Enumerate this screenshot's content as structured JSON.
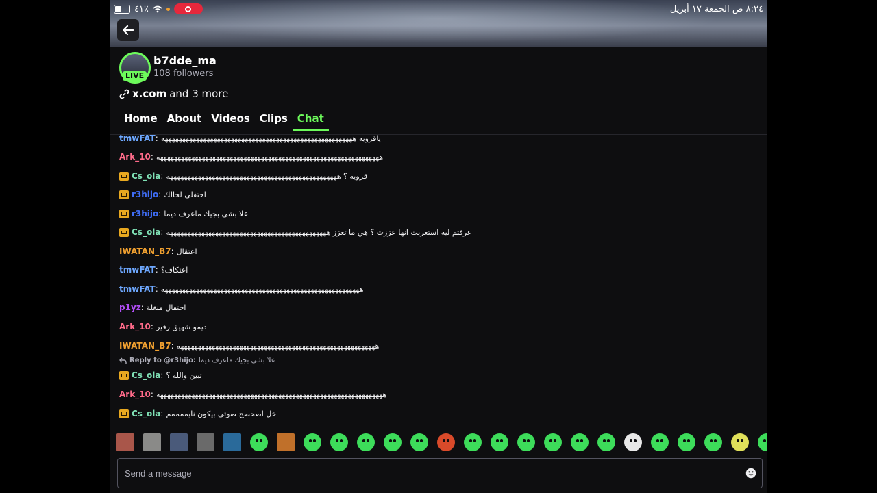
{
  "status_bar": {
    "time_date": "٨:٢٤ ص  الجمعة ١٧ أبريل",
    "battery_percent": "٤١٪"
  },
  "channel": {
    "username": "b7dde_ma",
    "followers": "108 followers",
    "live_badge": "LIVE",
    "link_main": "x.com",
    "link_more": "and 3 more"
  },
  "tabs": [
    {
      "label": "Home",
      "active": false
    },
    {
      "label": "About",
      "active": false
    },
    {
      "label": "Videos",
      "active": false
    },
    {
      "label": "Clips",
      "active": false
    },
    {
      "label": "Chat",
      "active": true
    }
  ],
  "messages": [
    {
      "user": "tmwFAT",
      "color": "#6ea8ff",
      "crown": false,
      "text": "ياقرويه هههههههههههههههههههههههههههههههههههههههههههههههههههههههه"
    },
    {
      "user": "Ark_10",
      "color": "#ff6b8a",
      "crown": false,
      "text": "ههههههههههههههههههههههههههههههههههههههههههههههههههههههههههههههههه"
    },
    {
      "user": "Cs_ola",
      "color": "#7fe0b5",
      "crown": true,
      "text": "قرويه ؟ هههههههههههههههههههههههههههههههههههههههههههههههههه"
    },
    {
      "user": "r3hijo",
      "color": "#3f6df6",
      "crown": true,
      "text": "احتفلي لحالك"
    },
    {
      "user": "r3hijo",
      "color": "#3f6df6",
      "crown": true,
      "text": "علا بشي بجيك ماعرف ديما"
    },
    {
      "user": "Cs_ola",
      "color": "#7fe0b5",
      "crown": true,
      "text": "عرفتم ليه استغربت انها عززت ؟ هي ما تعزز ههههههههههههههههههههههههههههههههههههههههههههههه"
    },
    {
      "user": "IWATAN_B7",
      "color": "#f0a030",
      "crown": false,
      "text": "اعتقال"
    },
    {
      "user": "tmwFAT",
      "color": "#6ea8ff",
      "crown": false,
      "text": "اعتكاف؟"
    },
    {
      "user": "tmwFAT",
      "color": "#6ea8ff",
      "crown": false,
      "text": "هههههههههههههههههههههههههههههههههههههههههههههههههههههههههه"
    },
    {
      "user": "p1yz",
      "color": "#b14ef7",
      "crown": false,
      "text": "احتفال منغلة"
    },
    {
      "user": "Ark_10",
      "color": "#ff6b8a",
      "crown": false,
      "text": "ديمو شهيق زفير"
    },
    {
      "user": "IWATAN_B7",
      "color": "#f0a030",
      "crown": false,
      "text": "هههههههههههههههههههههههههههههههههههههههههههههههههههههههههه"
    },
    {
      "user": "Cs_ola",
      "color": "#7fe0b5",
      "crown": true,
      "text": "تبين والله ؟"
    },
    {
      "user": "Ark_10",
      "color": "#ff6b8a",
      "crown": false,
      "text": "هههههههههههههههههههههههههههههههههههههههههههههههههههههههههههههههههه"
    },
    {
      "user": "Cs_ola",
      "color": "#7fe0b5",
      "crown": true,
      "text": "خل اصحصح صوتي بيكون نايممممم"
    }
  ],
  "reply": {
    "prefix": "Reply to @r3hijo:",
    "text": "علا بشي بجيك ماعرف ديما"
  },
  "emotes": [
    {
      "name": "avatar-emote-1",
      "color": "#a9564a",
      "photo": true
    },
    {
      "name": "avatar-emote-2",
      "color": "#8a8a88",
      "photo": true
    },
    {
      "name": "avatar-emote-3",
      "color": "#4a5a7a",
      "photo": true
    },
    {
      "name": "avatar-emote-4",
      "color": "#6a6a6a",
      "photo": true
    },
    {
      "name": "avatar-emote-5",
      "color": "#2a6a9a",
      "photo": true
    },
    {
      "name": "halo-emote",
      "color": "#3ddc5a",
      "photo": false
    },
    {
      "name": "box-emote",
      "color": "#c0702a",
      "photo": true
    },
    {
      "name": "dizzy-emote",
      "color": "#3ddc5a",
      "photo": false
    },
    {
      "name": "wink-emote",
      "color": "#3ddc5a",
      "photo": false
    },
    {
      "name": "headphones-emote",
      "color": "#3ddc5a",
      "photo": false
    },
    {
      "name": "smile-emote",
      "color": "#3ddc5a",
      "photo": false
    },
    {
      "name": "blob-emote",
      "color": "#3ddc5a",
      "photo": false
    },
    {
      "name": "mushroom-emote",
      "color": "#d94a2a",
      "photo": false
    },
    {
      "name": "grin-emote",
      "color": "#3ddc5a",
      "photo": false
    },
    {
      "name": "love-emote",
      "color": "#3ddc5a",
      "photo": false
    },
    {
      "name": "angry-emote",
      "color": "#3ddc5a",
      "photo": false
    },
    {
      "name": "sick-emote",
      "color": "#3ddc5a",
      "photo": false
    },
    {
      "name": "cringe-emote",
      "color": "#3ddc5a",
      "photo": false
    },
    {
      "name": "smirk-emote",
      "color": "#3ddc5a",
      "photo": false
    },
    {
      "name": "skull-emote",
      "color": "#e8e8e8",
      "photo": false
    },
    {
      "name": "devil-emote",
      "color": "#3ddc5a",
      "photo": false
    },
    {
      "name": "sweat-emote",
      "color": "#3ddc5a",
      "photo": false
    },
    {
      "name": "gamer-emote",
      "color": "#3ddc5a",
      "photo": false
    },
    {
      "name": "laptop-emote",
      "color": "#e0e05a",
      "photo": false
    },
    {
      "name": "partial-emote",
      "color": "#3ddc5a",
      "photo": false
    }
  ],
  "input": {
    "placeholder": "Send a message"
  }
}
